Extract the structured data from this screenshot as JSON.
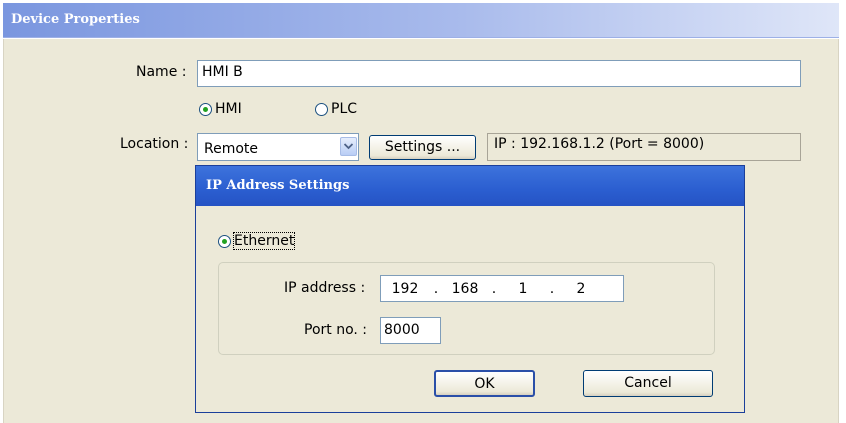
{
  "window": {
    "title": "Device Properties"
  },
  "device": {
    "name_label": "Name :",
    "name_value": "HMI B",
    "type_options": [
      {
        "label": "HMI",
        "selected": true
      },
      {
        "label": "PLC",
        "selected": false
      }
    ],
    "location_label": "Location :",
    "location_value": "Remote",
    "settings_button": "Settings ...",
    "ip_summary": "IP : 192.168.1.2 (Port = 8000)"
  },
  "ip_dialog": {
    "title": "IP Address Settings",
    "mode_option": {
      "label": "Ethernet",
      "selected": true
    },
    "ip_label": "IP address :",
    "ip_octets": [
      "192",
      "168",
      "1",
      "2"
    ],
    "port_label": "Port no. :",
    "port_value": "8000",
    "ok_button": "OK",
    "cancel_button": "Cancel"
  },
  "colors": {
    "title_bar_active": "#2b5ed0",
    "title_bar_inactive": "#a9bbec",
    "dialog_face": "#ece9d8",
    "radio_dot": "#21a121"
  },
  "icons": {
    "combo_arrow": "chevron-down-icon"
  }
}
